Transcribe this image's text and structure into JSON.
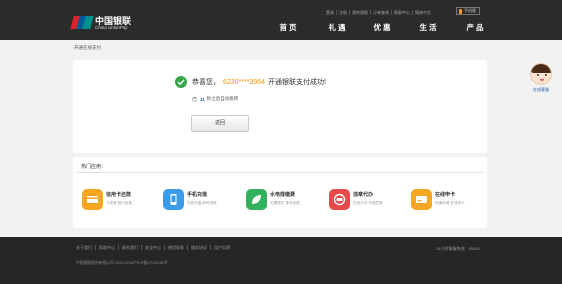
{
  "header": {
    "logo_cn": "中国银联",
    "logo_en": "China UnionPay",
    "top_links": [
      "登录",
      "注册",
      "我的银联",
      "订单查询",
      "帮助中心",
      "简体中文"
    ],
    "mobile_label": "手机版",
    "nav": [
      "首 页",
      "礼 遇",
      "优 惠",
      "生 活",
      "产 品"
    ]
  },
  "breadcrumb": "开通在线支付",
  "result": {
    "prefix": "恭喜您，",
    "card": "6230****3964",
    "suffix": "开通银联支付成功!",
    "redirect_seconds": "11",
    "redirect_text": "秒之后自动跳转",
    "back_label": "返回"
  },
  "apps": {
    "title": "热门应用：",
    "items": [
      {
        "name": "信用卡还款",
        "desc": "卡还款 跨行免费",
        "icon": "credit-card-icon",
        "color": "#f5a623"
      },
      {
        "name": "手机充值",
        "desc": "在线充值 即时到账",
        "icon": "mobile-phone-icon",
        "color": "#3b9be6"
      },
      {
        "name": "水电煤缴费",
        "desc": "无需排队 零手续费",
        "icon": "utility-leaf-icon",
        "color": "#33b05b"
      },
      {
        "name": "违章代办",
        "desc": "在线代办 代缴罚单",
        "icon": "car-icon",
        "color": "#e64a4a"
      },
      {
        "name": "在线申卡",
        "desc": "快速申请 在线申卡",
        "icon": "bank-card-icon",
        "color": "#f5a623"
      }
    ]
  },
  "footer": {
    "links": [
      "关于我们",
      "帮助中心",
      "联系我们",
      "安全中心",
      "使用条款",
      "服务协议",
      "用户反馈"
    ],
    "hotline": "24小时客服热线：95516",
    "copyright": "中国银联股份有限公司 2002-2016沪ICP备07032180号"
  },
  "customer_service": {
    "label": "在线客服"
  }
}
